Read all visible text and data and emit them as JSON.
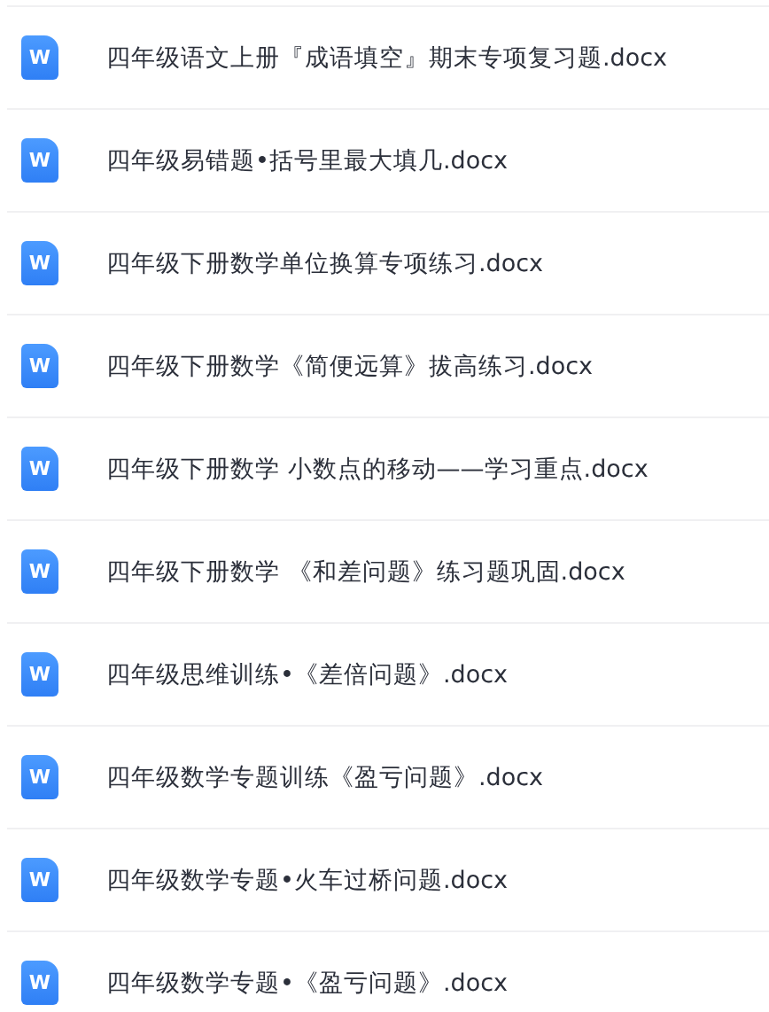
{
  "files": [
    {
      "icon_letter": "W",
      "name": "四年级语文上册『成语填空』期末专项复习题.docx"
    },
    {
      "icon_letter": "W",
      "name": "四年级易错题•括号里最大填几.docx"
    },
    {
      "icon_letter": "W",
      "name": "四年级下册数学单位换算专项练习.docx"
    },
    {
      "icon_letter": "W",
      "name": "四年级下册数学《简便远算》拔高练习.docx"
    },
    {
      "icon_letter": "W",
      "name": "四年级下册数学 小数点的移动——学习重点.docx"
    },
    {
      "icon_letter": "W",
      "name": "四年级下册数学 《和差问题》练习题巩固.docx"
    },
    {
      "icon_letter": "W",
      "name": "四年级思维训练•《差倍问题》.docx"
    },
    {
      "icon_letter": "W",
      "name": "四年级数学专题训练《盈亏问题》.docx"
    },
    {
      "icon_letter": "W",
      "name": "四年级数学专题•火车过桥问题.docx"
    },
    {
      "icon_letter": "W",
      "name": "四年级数学专题•《盈亏问题》.docx"
    }
  ]
}
